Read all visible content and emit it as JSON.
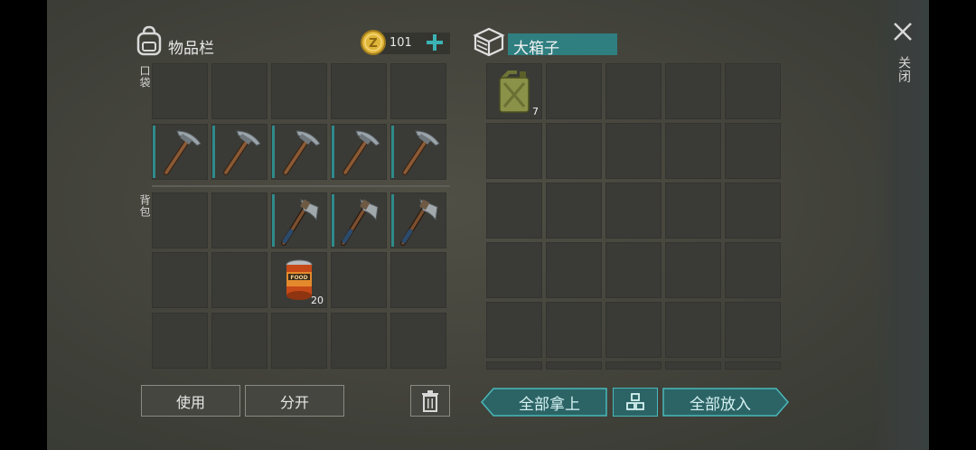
{
  "inventory": {
    "title": "物品栏",
    "coins": "101",
    "pocket_label": "口袋",
    "backpack_label": "背包",
    "use_button": "使用",
    "split_button": "分开"
  },
  "container": {
    "title": "大箱子",
    "take_all_button": "全部拿上",
    "put_all_button": "全部放入"
  },
  "close_label": "关闭",
  "items": {
    "food_can_count": "20",
    "jerrycan_count": "7",
    "can_label": "FOOD"
  },
  "colors": {
    "accent": "#2f8a8b",
    "slot": "#3a3b36",
    "coin": "#e0b63a"
  },
  "icons": [
    "backpack-icon",
    "coin-icon",
    "plus-icon",
    "crate-icon",
    "close-icon",
    "trash-icon",
    "sort-icon",
    "pickaxe-icon",
    "hatchet-icon",
    "food-can-icon",
    "jerrycan-icon"
  ]
}
